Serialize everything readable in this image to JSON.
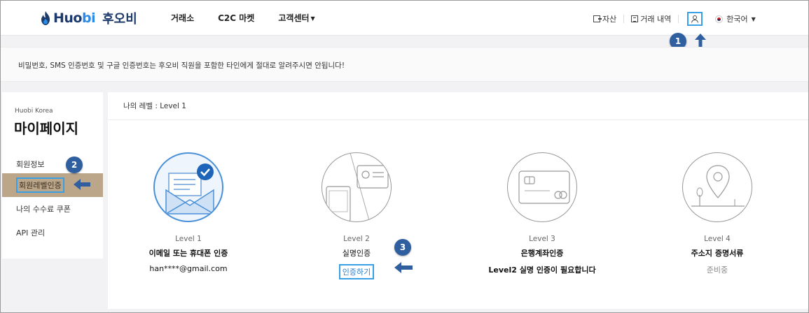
{
  "header": {
    "logo_text": "Huobi",
    "logo_text_bi": "bi",
    "logo_ko": "후오비",
    "nav": [
      {
        "label": "거래소"
      },
      {
        "label": "C2C 마켓"
      },
      {
        "label": "고객센터"
      }
    ],
    "assets_label": "자산",
    "trade_history_label": "거래 내역",
    "language_label": "한국어"
  },
  "callouts": [
    "1",
    "2",
    "3"
  ],
  "notice": {
    "text": "비밀번호, SMS 인증번호 및 구글 인증번호는 후오비 직원을 포함한 타인에게 절대로 알려주시면 안됩니다!"
  },
  "sidebar": {
    "brand": "Huobi Korea",
    "title": "마이페이지",
    "items": [
      {
        "label": "회원정보"
      },
      {
        "label": "회원레벨인증"
      },
      {
        "label": "나의 수수료 쿠폰"
      },
      {
        "label": "API 관리"
      }
    ]
  },
  "main": {
    "my_level": "나의 레벨 : Level 1",
    "levels": [
      {
        "level": "Level 1",
        "title": "이메일 또는 휴대폰 인증",
        "sub": "han****@gmail.com"
      },
      {
        "level": "Level 2",
        "title": "실명인증",
        "sub": "인증하기"
      },
      {
        "level": "Level 3",
        "title": "은행계좌인증",
        "sub": "Level2 실명 인증이 필요합니다"
      },
      {
        "level": "Level 4",
        "title": "주소지 증명서류",
        "sub": "준비중"
      }
    ]
  },
  "colors": {
    "brand_dark": "#1c3a6b",
    "brand_light": "#2b8be8",
    "highlight": "#3aa0e6",
    "callout": "#2f5f9f",
    "active_menu": "#bba68a"
  }
}
